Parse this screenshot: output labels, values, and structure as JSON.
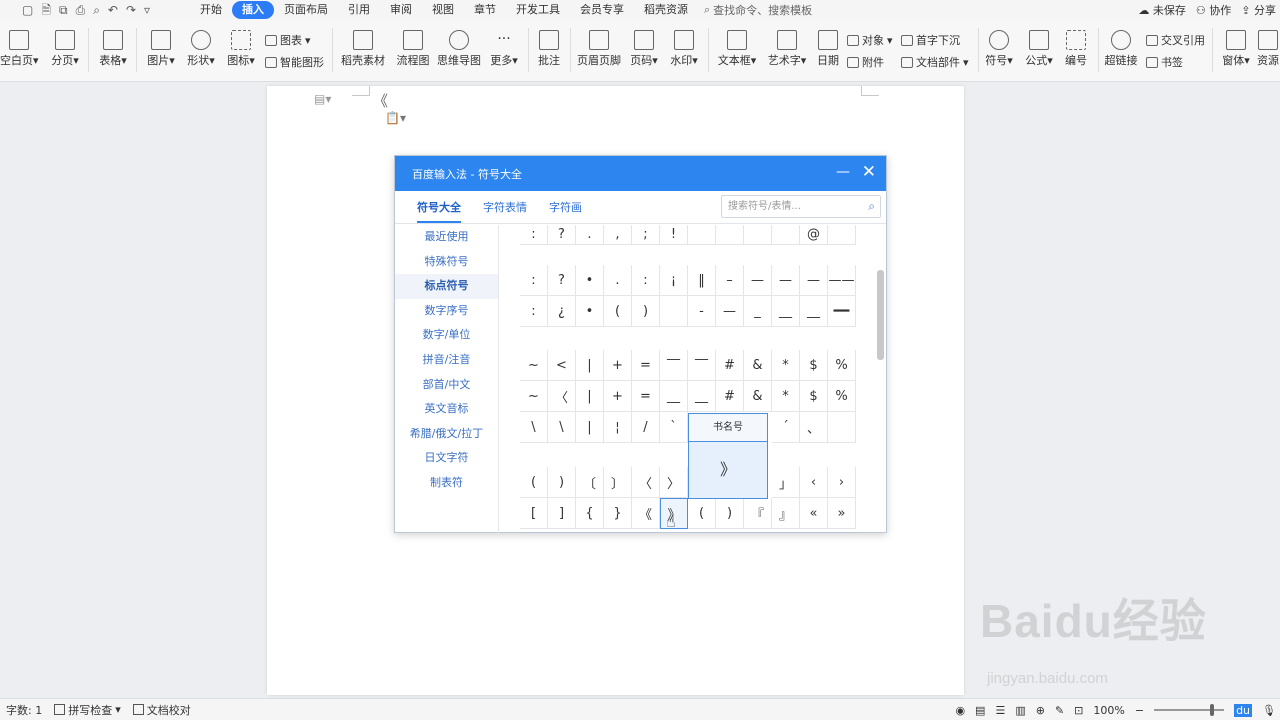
{
  "menubar": {
    "quick_icons": [
      "file-icon",
      "save-icon",
      "export-icon",
      "print-icon",
      "print-preview-icon",
      "undo-icon",
      "redo-icon",
      "more-icon"
    ],
    "tabs": [
      "开始",
      "插入",
      "页面布局",
      "引用",
      "审阅",
      "视图",
      "章节",
      "开发工具",
      "会员专享",
      "稻壳资源"
    ],
    "active_tab": "插入",
    "search_label": "查找命令、搜索模板",
    "unsaved": "未保存",
    "collab": "协作",
    "share": "分享"
  },
  "ribbon": {
    "blank_page": "空白页",
    "page_break": "分页",
    "table": "表格",
    "picture": "图片",
    "shape": "形状",
    "icon": "图标",
    "chart": "图表",
    "smart_shape": "智能图形",
    "docer_material": "稻壳素材",
    "flowchart": "流程图",
    "mindmap": "思维导图",
    "more": "更多",
    "comment": "批注",
    "header_footer": "页眉页脚",
    "page_number": "页码",
    "watermark": "水印",
    "textbox": "文本框",
    "wordart": "艺术字",
    "date": "日期",
    "object": "对象",
    "attachment": "附件",
    "drop_cap": "首字下沉",
    "doc_parts": "文档部件",
    "symbol": "符号",
    "formula": "公式",
    "numbering": "编号",
    "hyperlink": "超链接",
    "cross_ref": "交叉引用",
    "bookmark": "书签",
    "window": "窗体",
    "resources": "资源"
  },
  "dialog": {
    "title": "百度输入法 - 符号大全",
    "tabs": [
      "符号大全",
      "字符表情",
      "字符画"
    ],
    "active_tab": "符号大全",
    "search_placeholder": "搜索符号/表情...",
    "categories": [
      "最近使用",
      "特殊符号",
      "标点符号",
      "数字序号",
      "数字/单位",
      "拼音/注音",
      "部首/中文",
      "英文音标",
      "希腊/俄文/拉丁",
      "日文字符",
      "制表符"
    ],
    "active_category": "标点符号",
    "rows": [
      [
        ":",
        "?",
        ".",
        ",",
        ";",
        "!",
        "",
        "",
        "",
        "",
        "@",
        ""
      ],
      [
        ":",
        "?",
        "•",
        ".",
        ":",
        "¡",
        "‖",
        "–",
        "—",
        "—",
        "—",
        "——"
      ],
      [
        ":",
        "¿",
        "•",
        "(",
        ")",
        "",
        "-",
        "—",
        "_",
        "__",
        "__",
        "━━"
      ],
      [
        "~",
        "<",
        "|",
        "+",
        "=",
        "‾‾",
        "‾‾",
        "#",
        "&",
        "*",
        "$",
        "%"
      ],
      [
        "~",
        "〈",
        "|",
        "+",
        "=",
        "__",
        "__",
        "#",
        "&",
        "*",
        "$",
        "%"
      ],
      [
        "\\",
        "\\",
        "|",
        "¦",
        "/",
        "`",
        "",
        "",
        "",
        "´",
        "、",
        ""
      ],
      [
        "(",
        ")",
        "〔",
        "〕",
        "〈",
        "〉",
        "",
        "",
        "",
        "」",
        "‹",
        "›"
      ],
      [
        "[",
        "]",
        "{",
        "}",
        "《",
        "》",
        "(",
        ")",
        "『",
        "』",
        "«",
        "»"
      ]
    ],
    "preview": {
      "title": "书名号",
      "char": "》"
    }
  },
  "document": {
    "margin_icon": "page-icon",
    "collapse_glyph": "《",
    "paste_icon": "paste-icon"
  },
  "status": {
    "word_count": "字数: 1",
    "spellcheck": "拼写检查",
    "proofread": "文档校对",
    "zoom": "100%"
  },
  "watermark": {
    "brand": "Baidu经验",
    "url": "jingyan.baidu.com"
  }
}
